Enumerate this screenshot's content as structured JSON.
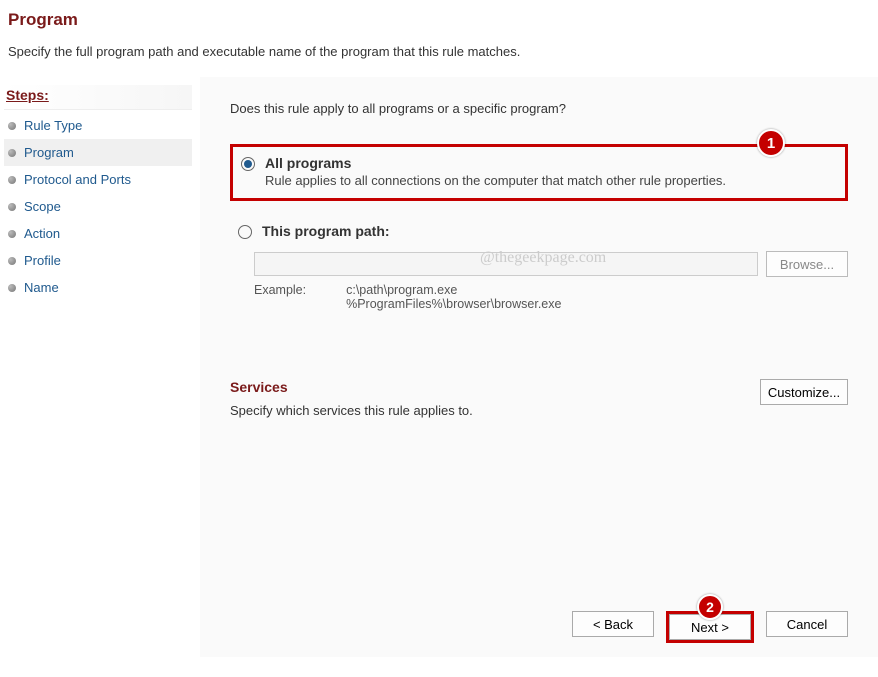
{
  "header": {
    "title": "Program",
    "subtitle": "Specify the full program path and executable name of the program that this rule matches."
  },
  "sidebar": {
    "title": "Steps:",
    "items": [
      {
        "label": "Rule Type",
        "active": false
      },
      {
        "label": "Program",
        "active": true
      },
      {
        "label": "Protocol and Ports",
        "active": false
      },
      {
        "label": "Scope",
        "active": false
      },
      {
        "label": "Action",
        "active": false
      },
      {
        "label": "Profile",
        "active": false
      },
      {
        "label": "Name",
        "active": false
      }
    ]
  },
  "main": {
    "question": "Does this rule apply to all programs or a specific program?",
    "option_all": {
      "title": "All programs",
      "desc": "Rule applies to all connections on the computer that match other rule properties."
    },
    "option_path": {
      "title": "This program path:",
      "input_value": "",
      "browse": "Browse...",
      "example_label": "Example:",
      "example1": "c:\\path\\program.exe",
      "example2": "%ProgramFiles%\\browser\\browser.exe"
    },
    "services": {
      "title": "Services",
      "desc": "Specify which services this rule applies to.",
      "customize": "Customize..."
    },
    "buttons": {
      "back": "< Back",
      "next": "Next >",
      "cancel": "Cancel"
    }
  },
  "callouts": {
    "one": "1",
    "two": "2"
  },
  "watermark": "@thegeekpage.com"
}
